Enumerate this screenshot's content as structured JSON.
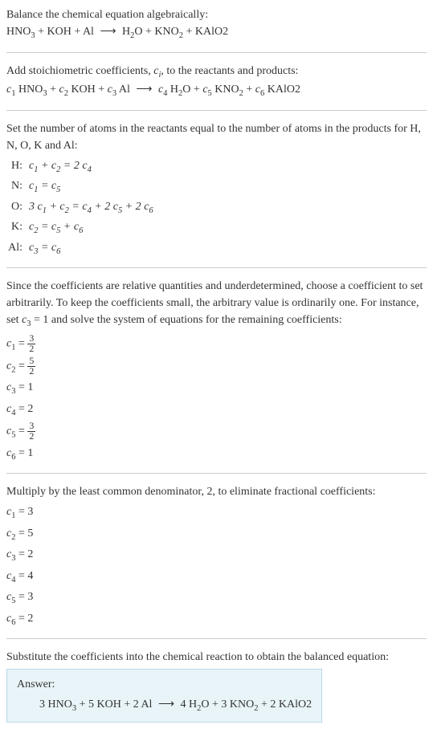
{
  "intro": {
    "line1": "Balance the chemical equation algebraically:",
    "reaction_left": "HNO",
    "reaction_sub1": "3",
    "reaction_plus1": " + KOH + Al ",
    "arrow": "⟶",
    "reaction_right1": " H",
    "reaction_sub2": "2",
    "reaction_right2": "O + KNO",
    "reaction_sub3": "2",
    "reaction_right3": " + KAlO2"
  },
  "stoich": {
    "line1_a": "Add stoichiometric coefficients, ",
    "line1_ci": "c",
    "line1_i": "i",
    "line1_b": ", to the reactants and products:",
    "c1": "c",
    "s1": "1",
    "t1": " HNO",
    "sub1": "3",
    "plus1": " + ",
    "c2": "c",
    "s2": "2",
    "t2": " KOH + ",
    "c3": "c",
    "s3": "3",
    "t3": " Al ",
    "arrow": "⟶",
    "sp": " ",
    "c4": "c",
    "s4": "4",
    "t4": " H",
    "sub4": "2",
    "t4b": "O + ",
    "c5": "c",
    "s5": "5",
    "t5": " KNO",
    "sub5": "2",
    "plus5": " + ",
    "c6": "c",
    "s6": "6",
    "t6": " KAlO2"
  },
  "atoms": {
    "intro1": "Set the number of atoms in the reactants equal to the number of atoms in the products for H, N, O, K and Al:",
    "rows": [
      {
        "label": "H:",
        "eq": "c₁ + c₂ = 2 c₄"
      },
      {
        "label": "N:",
        "eq": "c₁ = c₅"
      },
      {
        "label": "O:",
        "eq": "3 c₁ + c₂ = c₄ + 2 c₅ + 2 c₆"
      },
      {
        "label": "K:",
        "eq": "c₂ = c₅ + c₆"
      },
      {
        "label": "Al:",
        "eq": "c₃ = c₆"
      }
    ]
  },
  "relative": {
    "text": "Since the coefficients are relative quantities and underdetermined, choose a coefficient to set arbitrarily. To keep the coefficients small, the arbitrary value is ordinarily one. For instance, set c₃ = 1 and solve the system of equations for the remaining coefficients:",
    "coeffs": [
      {
        "c": "c",
        "sub": "1",
        "eq": " = ",
        "num": "3",
        "den": "2",
        "frac": true
      },
      {
        "c": "c",
        "sub": "2",
        "eq": " = ",
        "num": "5",
        "den": "2",
        "frac": true
      },
      {
        "c": "c",
        "sub": "3",
        "eq": " = ",
        "val": "1",
        "frac": false
      },
      {
        "c": "c",
        "sub": "4",
        "eq": " = ",
        "val": "2",
        "frac": false
      },
      {
        "c": "c",
        "sub": "5",
        "eq": " = ",
        "num": "3",
        "den": "2",
        "frac": true
      },
      {
        "c": "c",
        "sub": "6",
        "eq": " = ",
        "val": "1",
        "frac": false
      }
    ]
  },
  "multiply": {
    "text": "Multiply by the least common denominator, 2, to eliminate fractional coefficients:",
    "coeffs": [
      {
        "c": "c",
        "sub": "1",
        "eq": " = 3"
      },
      {
        "c": "c",
        "sub": "2",
        "eq": " = 5"
      },
      {
        "c": "c",
        "sub": "3",
        "eq": " = 2"
      },
      {
        "c": "c",
        "sub": "4",
        "eq": " = 4"
      },
      {
        "c": "c",
        "sub": "5",
        "eq": " = 3"
      },
      {
        "c": "c",
        "sub": "6",
        "eq": " = 2"
      }
    ]
  },
  "substitute": {
    "text": "Substitute the coefficients into the chemical reaction to obtain the balanced equation:"
  },
  "answer": {
    "label": "Answer:",
    "p1": "3 HNO",
    "s1": "3",
    "p2": " + 5 KOH + 2 Al ",
    "arrow": "⟶",
    "p3": " 4 H",
    "s3": "2",
    "p4": "O + 3 KNO",
    "s4": "2",
    "p5": " + 2 KAlO2"
  }
}
